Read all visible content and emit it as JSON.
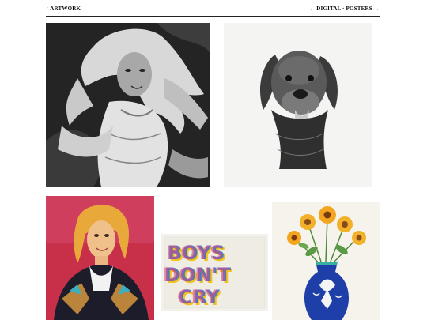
{
  "nav": {
    "up_label": "↑ ARTWORK",
    "sections_label": "← DIGITAL · POSTERS →"
  },
  "artworks": [
    {
      "name": "charcoal-girl",
      "medium": "charcoal"
    },
    {
      "name": "dog-pencil",
      "medium": "graphite"
    },
    {
      "name": "portrait-painting",
      "medium": "paint"
    },
    {
      "name": "boys-dont-cry-print",
      "text": "BOYS DON'T CRY"
    },
    {
      "name": "sunflower-vase",
      "medium": "colored pencil"
    }
  ],
  "colors": {
    "background": "#ffffff",
    "text": "#111111",
    "rule": "#222222"
  }
}
